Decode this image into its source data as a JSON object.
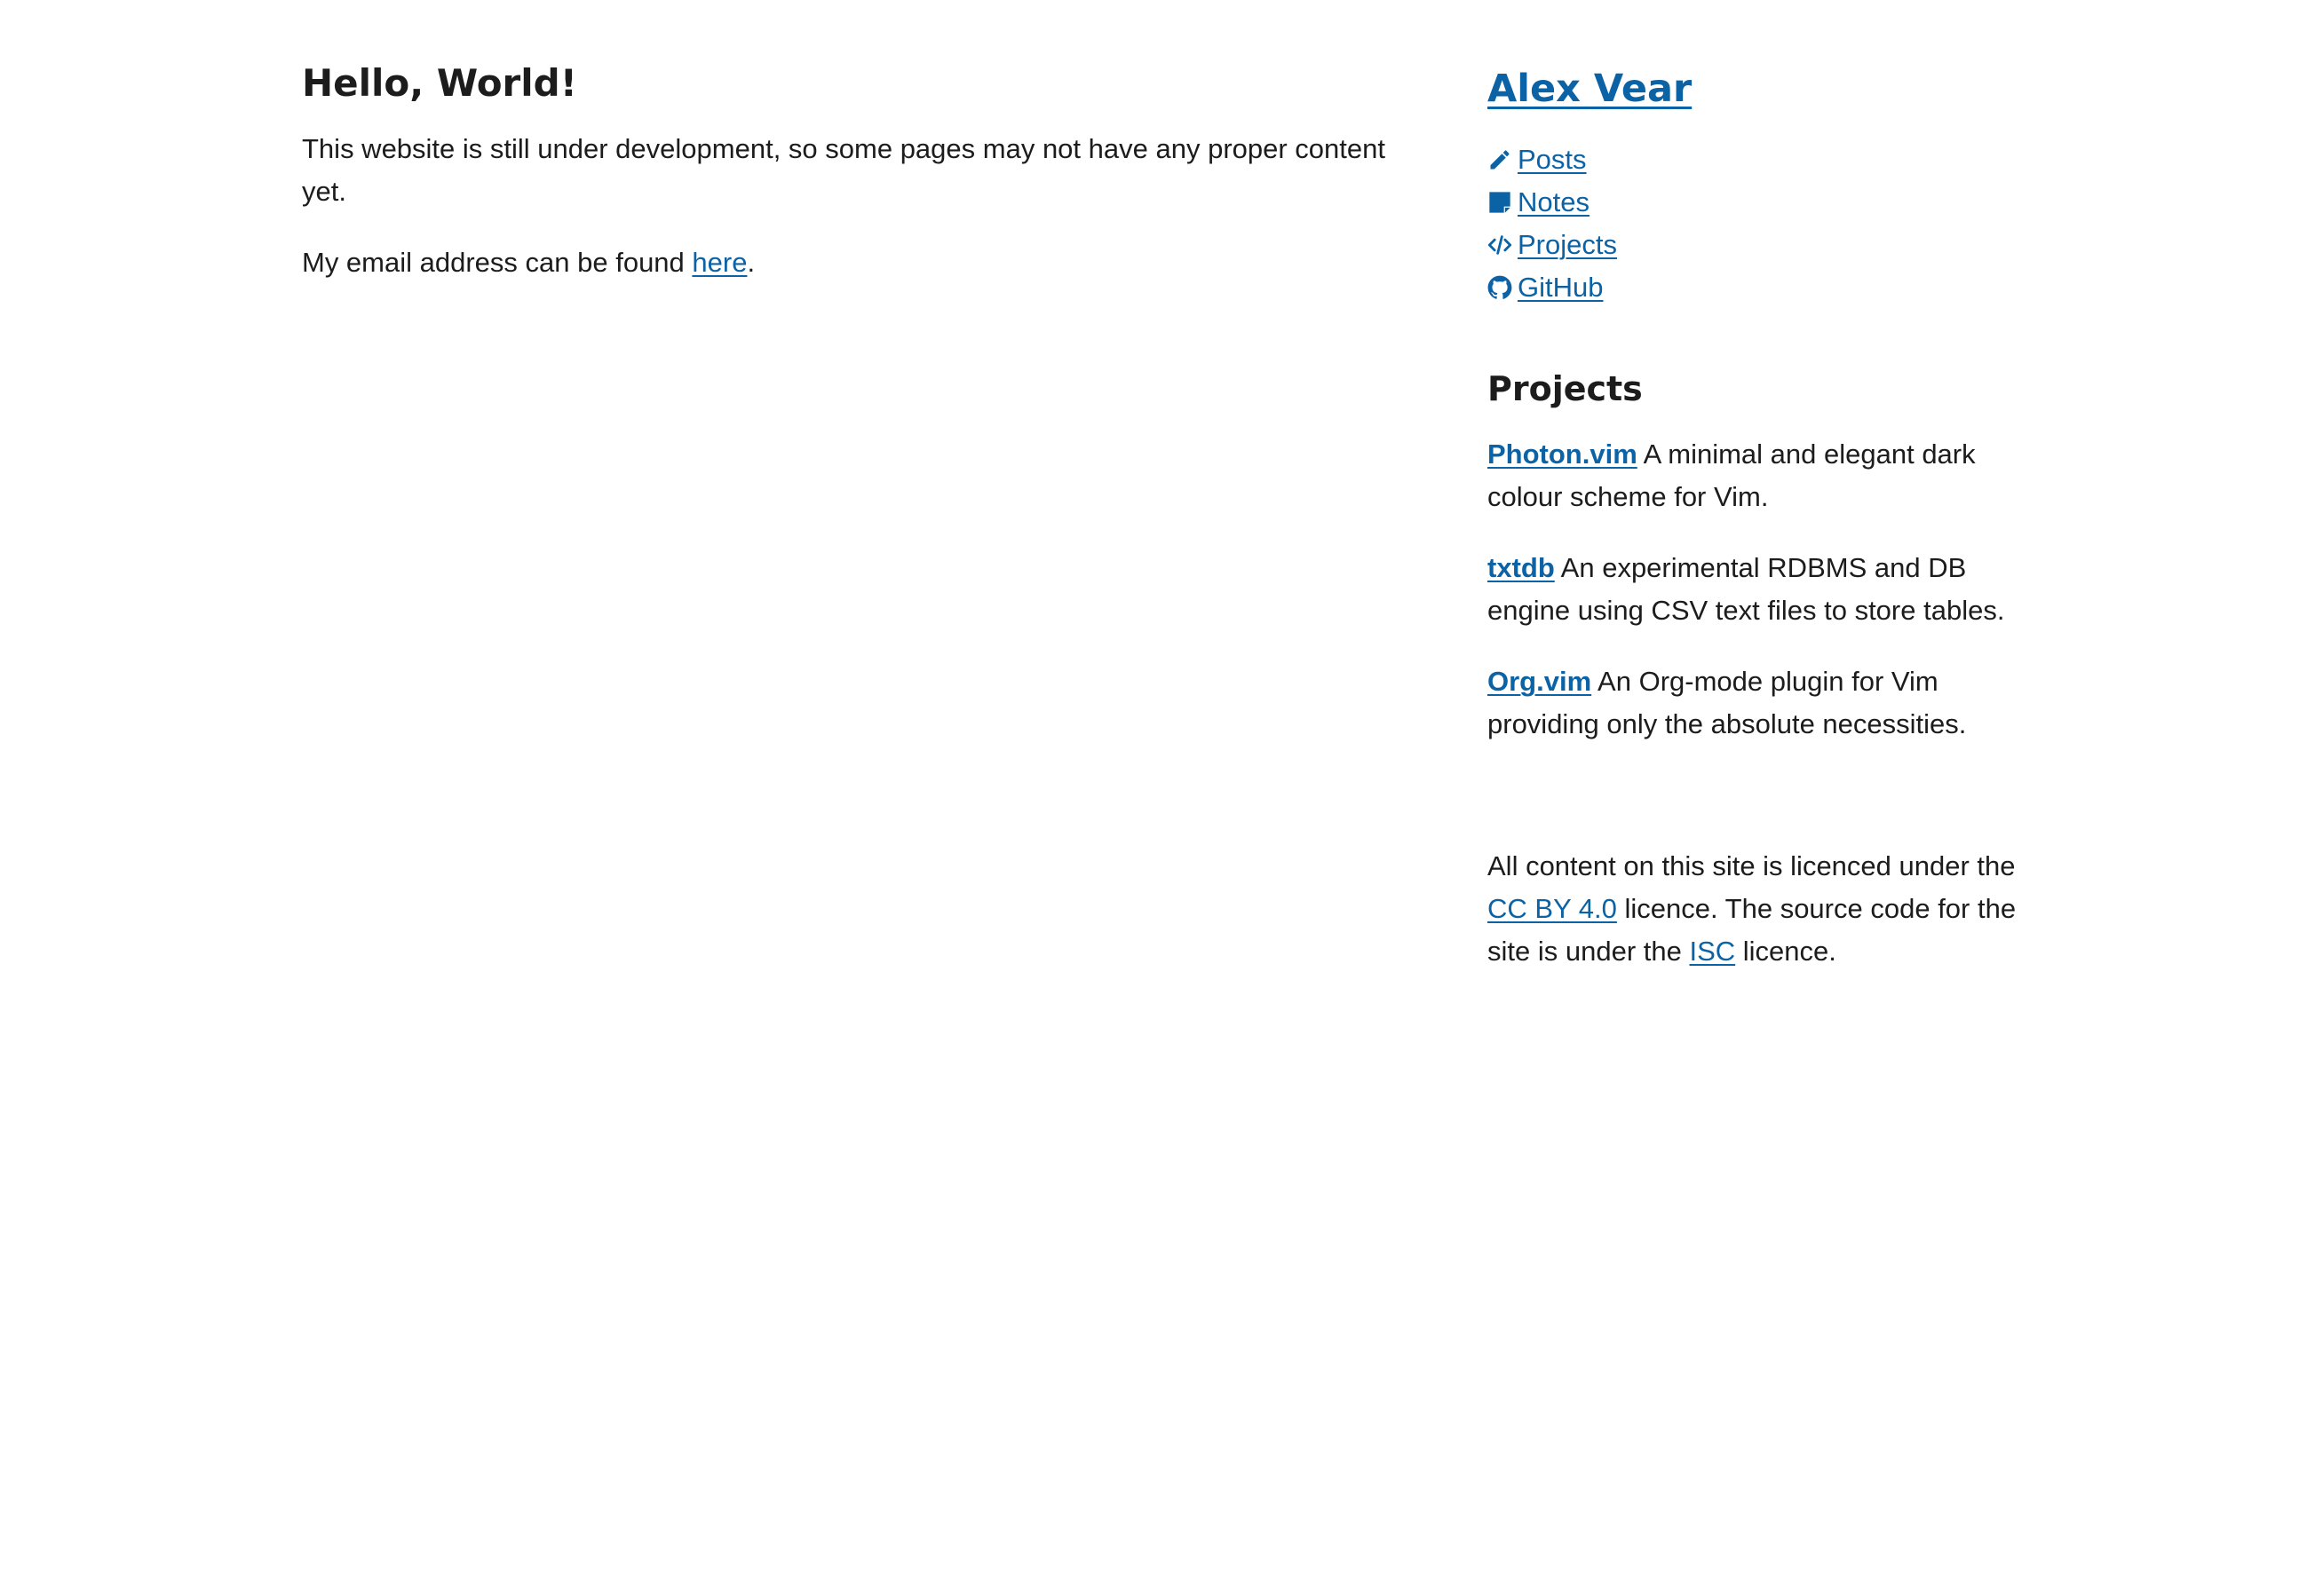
{
  "main": {
    "heading": "Hello, World!",
    "intro": "This website is still under development, so some pages may not have any proper content yet.",
    "email_prefix": "My email address can be found ",
    "email_link": "here",
    "email_suffix": "."
  },
  "sidebar": {
    "site_title": "Alex Vear",
    "nav": [
      {
        "label": " Posts",
        "icon": "pencil-icon"
      },
      {
        "label": " Notes",
        "icon": "sticky-note-icon"
      },
      {
        "label": " Projects",
        "icon": "code-icon"
      },
      {
        "label": " GitHub",
        "icon": "github-icon"
      }
    ],
    "projects_heading": "Projects",
    "projects": [
      {
        "name": "Photon.vim",
        "description": " A minimal and elegant dark colour scheme for Vim."
      },
      {
        "name": "txtdb",
        "description": " An experimental RDBMS and DB engine using CSV text files to store tables."
      },
      {
        "name": "Org.vim",
        "description": " An Org-mode plugin for Vim providing only the absolute necessities."
      }
    ],
    "license": {
      "prefix": "All content on this site is licenced under the ",
      "cc_link": "CC BY 4.0",
      "middle": " licence. The source code for the site is under the ",
      "isc_link": "ISC",
      "suffix": " licence."
    }
  },
  "colors": {
    "link": "#0b62a5",
    "text": "#1c1c1c",
    "background": "#ffffff"
  }
}
